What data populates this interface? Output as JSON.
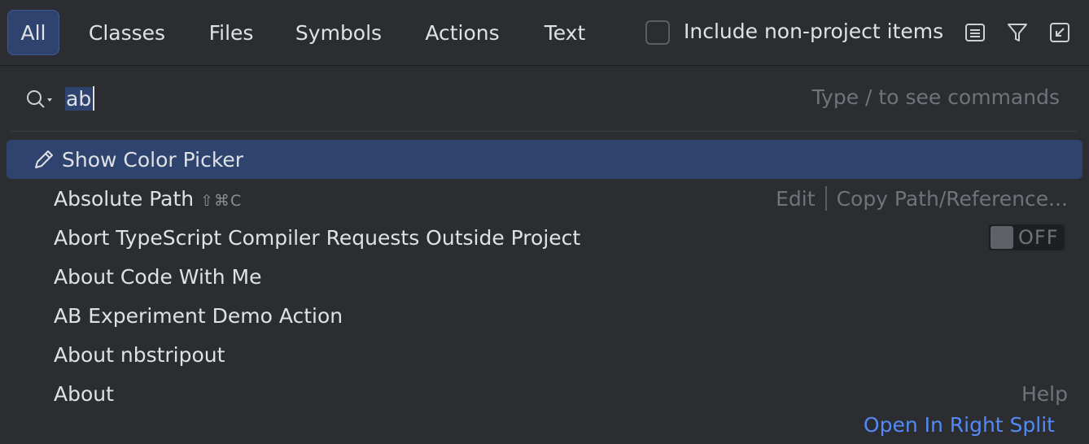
{
  "tabs": [
    {
      "label": "All",
      "active": true
    },
    {
      "label": "Classes"
    },
    {
      "label": "Files"
    },
    {
      "label": "Symbols"
    },
    {
      "label": "Actions"
    },
    {
      "label": "Text"
    }
  ],
  "include_non_project": {
    "label": "Include non-project items",
    "checked": false
  },
  "toolbar_icons": [
    "list-preview-icon",
    "filter-icon",
    "open-in-window-icon"
  ],
  "search": {
    "value": "ab",
    "hint": "Type / to see commands"
  },
  "results": [
    {
      "label": "Show Color Picker",
      "icon": "pencil-icon",
      "selected": true
    },
    {
      "label": "Absolute Path",
      "shortcut": "⇧⌘C",
      "right_group": "Edit",
      "right_detail": "Copy Path/Reference..."
    },
    {
      "label": "Abort TypeScript Compiler Requests Outside Project",
      "toggle": "OFF"
    },
    {
      "label": "About Code With Me"
    },
    {
      "label": "AB Experiment Demo Action"
    },
    {
      "label": "About nbstripout"
    },
    {
      "label": "About",
      "right_group": "Help"
    }
  ],
  "footer": {
    "open_split": "Open In Right Split"
  },
  "colors": {
    "background": "#2b2d30",
    "selection": "#2e436e",
    "link": "#548af7"
  }
}
